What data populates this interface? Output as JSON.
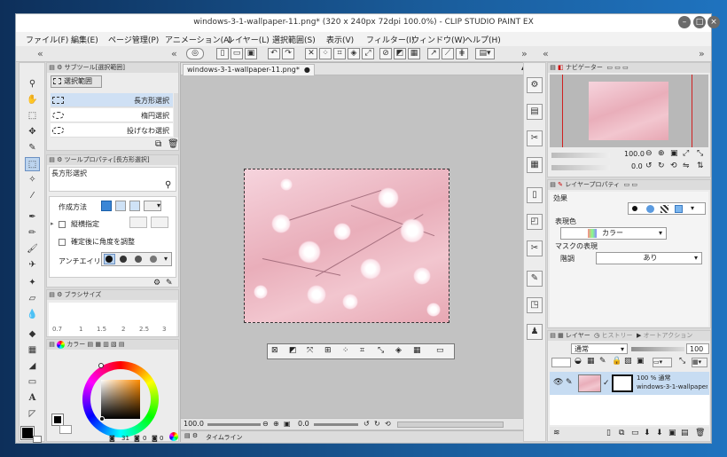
{
  "window": {
    "title": "windows-3-1-wallpaper-11.png* (320 x 240px 72dpi 100.0%) - CLIP STUDIO PAINT EX",
    "minimize_glyph": "–",
    "maximize_glyph": "□",
    "close_glyph": "×"
  },
  "menu": [
    "ファイル(F)",
    "編集(E)",
    "ページ管理(P)",
    "アニメーション(A)",
    "レイヤー(L)",
    "選択範囲(S)",
    "表示(V)",
    "フィルター(I)",
    "ウィンドウ(W)",
    "ヘルプ(H)"
  ],
  "subtool": {
    "header": "サブツール[選択範囲]",
    "group_label": "選択範囲",
    "items": [
      "長方形選択",
      "楕円選択",
      "投げなわ選択"
    ]
  },
  "toolprop": {
    "header": "ツールプロパティ[長方形選択]",
    "name": "長方形選択",
    "create_method_label": "作成方法",
    "aspect_label": "縦横指定",
    "angle_label": "確定後に角度を調整",
    "antialias_label": "アンチエイリ"
  },
  "brushsize": {
    "header": "ブラシサイズ",
    "values": [
      "0.7",
      "1",
      "1.5",
      "2",
      "2.5",
      "3"
    ]
  },
  "color": {
    "tab_label": "カラー",
    "readout": [
      "31",
      "0",
      "0"
    ]
  },
  "document": {
    "tab_label": "windows-3-1-wallpaper-11.png*",
    "zoom": "100.0",
    "angle": "0.0",
    "timeline_label": "タイムライン"
  },
  "navigator": {
    "tab_label": "ナビゲーター",
    "zoom": "100.0",
    "angle": "0.0"
  },
  "layerprop": {
    "tab_label": "レイヤープロパティ",
    "effect_label": "効果",
    "color_expr_label": "表現色",
    "color_expr_value": "カラー",
    "mask_label": "マスクの表現",
    "tone_label": "階調",
    "tone_value": "あり"
  },
  "layers": {
    "tab_label": "レイヤー",
    "history_label": "ヒストリー",
    "auto_action_label": "オートアクション",
    "blend_mode": "通常",
    "opacity": "100",
    "layer_opacity_mode": "100 % 通常",
    "layer_name": "windows-3-1-wallpaper-11"
  }
}
